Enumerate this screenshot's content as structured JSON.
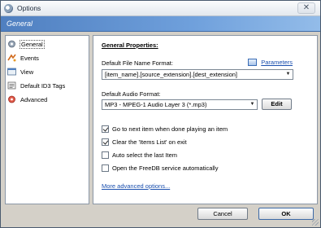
{
  "window": {
    "title": "Options",
    "close_glyph": "✕"
  },
  "header": {
    "title": "General"
  },
  "sidebar": {
    "items": [
      {
        "label": "General",
        "icon": "gear-icon",
        "selected": true
      },
      {
        "label": "Events",
        "icon": "events-icon",
        "selected": false
      },
      {
        "label": "View",
        "icon": "view-icon",
        "selected": false
      },
      {
        "label": "Default ID3 Tags",
        "icon": "tags-icon",
        "selected": false
      },
      {
        "label": "Advanced",
        "icon": "advanced-icon",
        "selected": false
      }
    ]
  },
  "panel": {
    "section_title": "General Properties:",
    "file_name_format_label": "Default File Name Format:",
    "parameters_link": "Parameters",
    "file_name_format_value": "[item_name].[source_extension].[dest_extension]",
    "audio_format_label": "Default Audio Format:",
    "audio_format_value": "MP3 - MPEG-1 Audio Layer 3 (*.mp3)",
    "edit_button": "Edit",
    "checkboxes": [
      {
        "label": "Go to next item when done playing an item",
        "checked": true
      },
      {
        "label": "Clear the 'Items List' on exit",
        "checked": true
      },
      {
        "label": "Auto select the last Item",
        "checked": false
      },
      {
        "label": "Open the FreeDB service automatically",
        "checked": false
      }
    ],
    "more_link": "More advanced options..."
  },
  "buttons": {
    "cancel": "Cancel",
    "ok": "OK"
  }
}
